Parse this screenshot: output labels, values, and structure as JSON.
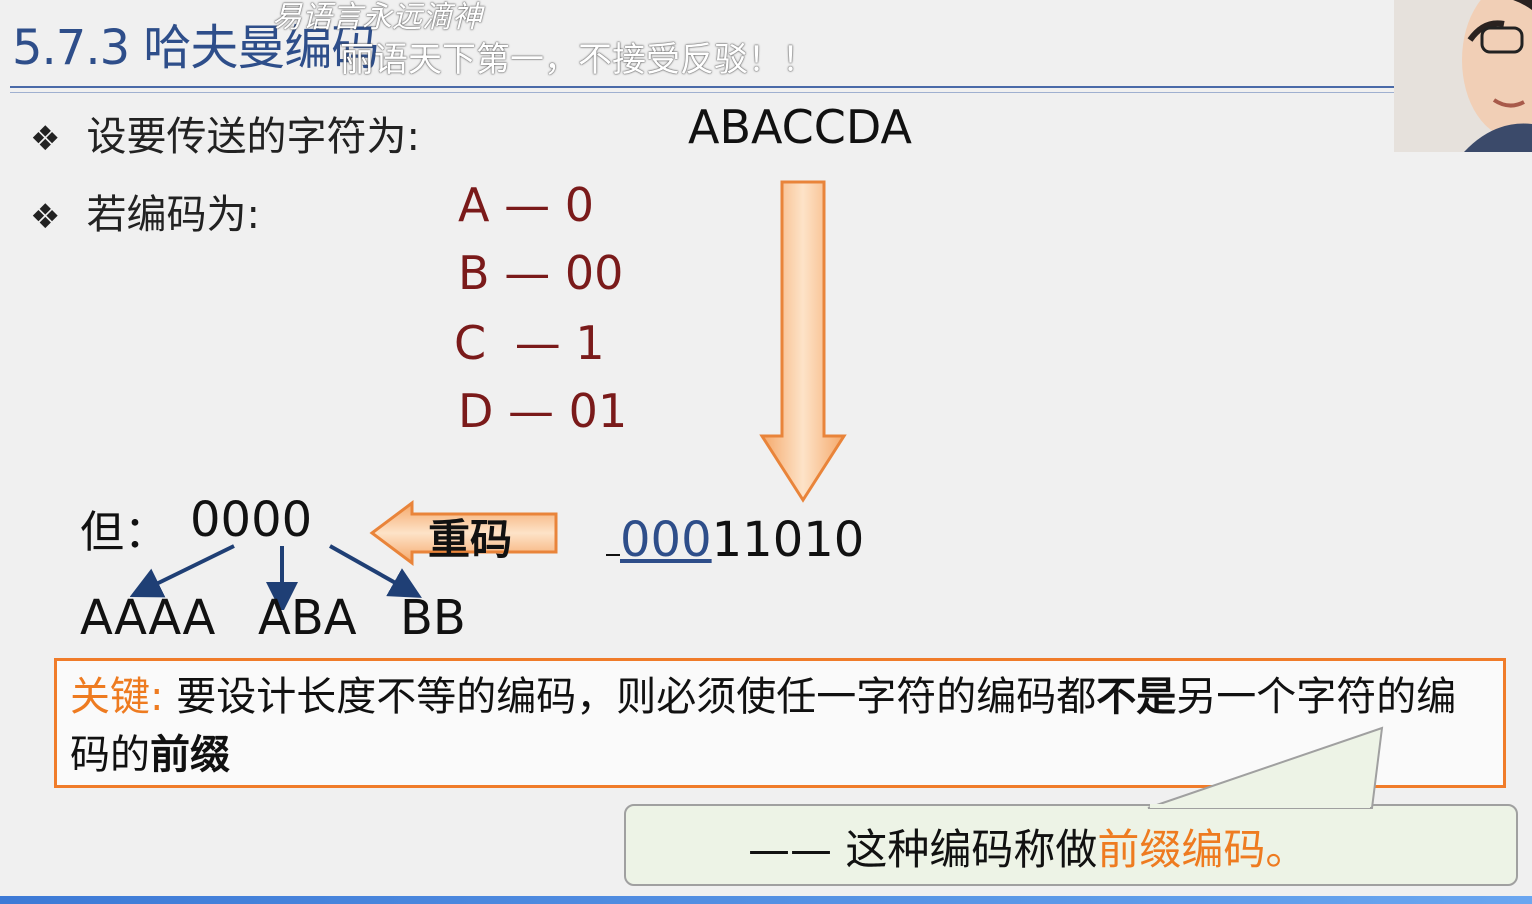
{
  "slide": {
    "title": "5.7.3 哈夫曼编码",
    "danmaku": [
      "易语言永远滴神",
      "丽语天下第一，不接受反驳！！"
    ],
    "bullets": [
      {
        "label": "设要传送的字符为:",
        "value": "ABACCDA"
      },
      {
        "label": "若编码为:"
      }
    ],
    "codes": [
      {
        "char": "A",
        "dash": "—",
        "code": "0"
      },
      {
        "char": "B",
        "dash": "—",
        "code": "00"
      },
      {
        "char": "C",
        "dash": "—",
        "code": "1"
      },
      {
        "char": "D",
        "dash": "—",
        "code": "01"
      }
    ],
    "but_label": "但：",
    "but_value": "0000",
    "decodings": [
      "AAAA",
      "ABA",
      "BB"
    ],
    "ambiguity_arrow_label": "重码",
    "encoded": {
      "underlined": "000",
      "rest": "11010"
    },
    "key": {
      "prefix": "关键:",
      "text1": "要设计长度不等的编码，则必须使任一字符的编码都",
      "bold1": "不是",
      "text2": "另一个字符的编码的",
      "bold2": "前缀"
    },
    "note": {
      "dash": "——",
      "text": " 这种编码称做",
      "highlight": "前缀编码",
      "end": "。"
    }
  },
  "colors": {
    "title": "#2e4e8a",
    "code_text": "#7a1a1a",
    "accent_orange": "#ee7b20",
    "arrow_fill": "#f8c08a",
    "dark_blue_arrow": "#1f3f75",
    "bubble_bg": "#edf3e6"
  }
}
